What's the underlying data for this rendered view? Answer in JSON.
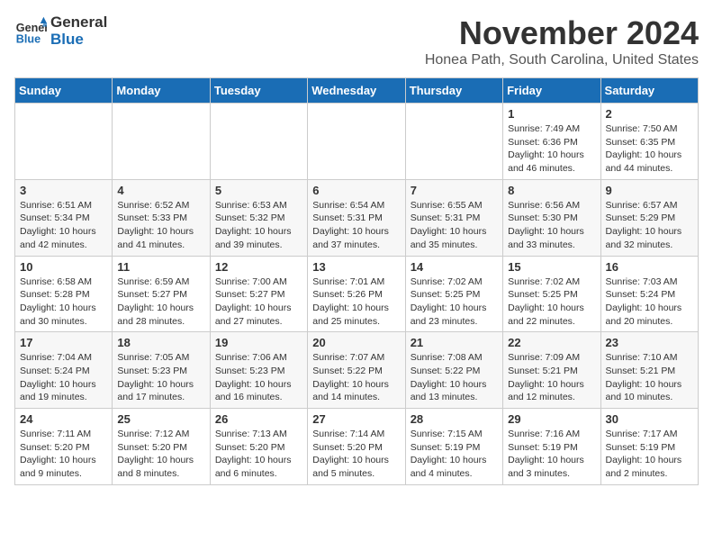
{
  "header": {
    "logo_line1": "General",
    "logo_line2": "Blue",
    "month": "November 2024",
    "location": "Honea Path, South Carolina, United States"
  },
  "weekdays": [
    "Sunday",
    "Monday",
    "Tuesday",
    "Wednesday",
    "Thursday",
    "Friday",
    "Saturday"
  ],
  "weeks": [
    [
      {
        "day": "",
        "info": ""
      },
      {
        "day": "",
        "info": ""
      },
      {
        "day": "",
        "info": ""
      },
      {
        "day": "",
        "info": ""
      },
      {
        "day": "",
        "info": ""
      },
      {
        "day": "1",
        "info": "Sunrise: 7:49 AM\nSunset: 6:36 PM\nDaylight: 10 hours\nand 46 minutes."
      },
      {
        "day": "2",
        "info": "Sunrise: 7:50 AM\nSunset: 6:35 PM\nDaylight: 10 hours\nand 44 minutes."
      }
    ],
    [
      {
        "day": "3",
        "info": "Sunrise: 6:51 AM\nSunset: 5:34 PM\nDaylight: 10 hours\nand 42 minutes."
      },
      {
        "day": "4",
        "info": "Sunrise: 6:52 AM\nSunset: 5:33 PM\nDaylight: 10 hours\nand 41 minutes."
      },
      {
        "day": "5",
        "info": "Sunrise: 6:53 AM\nSunset: 5:32 PM\nDaylight: 10 hours\nand 39 minutes."
      },
      {
        "day": "6",
        "info": "Sunrise: 6:54 AM\nSunset: 5:31 PM\nDaylight: 10 hours\nand 37 minutes."
      },
      {
        "day": "7",
        "info": "Sunrise: 6:55 AM\nSunset: 5:31 PM\nDaylight: 10 hours\nand 35 minutes."
      },
      {
        "day": "8",
        "info": "Sunrise: 6:56 AM\nSunset: 5:30 PM\nDaylight: 10 hours\nand 33 minutes."
      },
      {
        "day": "9",
        "info": "Sunrise: 6:57 AM\nSunset: 5:29 PM\nDaylight: 10 hours\nand 32 minutes."
      }
    ],
    [
      {
        "day": "10",
        "info": "Sunrise: 6:58 AM\nSunset: 5:28 PM\nDaylight: 10 hours\nand 30 minutes."
      },
      {
        "day": "11",
        "info": "Sunrise: 6:59 AM\nSunset: 5:27 PM\nDaylight: 10 hours\nand 28 minutes."
      },
      {
        "day": "12",
        "info": "Sunrise: 7:00 AM\nSunset: 5:27 PM\nDaylight: 10 hours\nand 27 minutes."
      },
      {
        "day": "13",
        "info": "Sunrise: 7:01 AM\nSunset: 5:26 PM\nDaylight: 10 hours\nand 25 minutes."
      },
      {
        "day": "14",
        "info": "Sunrise: 7:02 AM\nSunset: 5:25 PM\nDaylight: 10 hours\nand 23 minutes."
      },
      {
        "day": "15",
        "info": "Sunrise: 7:02 AM\nSunset: 5:25 PM\nDaylight: 10 hours\nand 22 minutes."
      },
      {
        "day": "16",
        "info": "Sunrise: 7:03 AM\nSunset: 5:24 PM\nDaylight: 10 hours\nand 20 minutes."
      }
    ],
    [
      {
        "day": "17",
        "info": "Sunrise: 7:04 AM\nSunset: 5:24 PM\nDaylight: 10 hours\nand 19 minutes."
      },
      {
        "day": "18",
        "info": "Sunrise: 7:05 AM\nSunset: 5:23 PM\nDaylight: 10 hours\nand 17 minutes."
      },
      {
        "day": "19",
        "info": "Sunrise: 7:06 AM\nSunset: 5:23 PM\nDaylight: 10 hours\nand 16 minutes."
      },
      {
        "day": "20",
        "info": "Sunrise: 7:07 AM\nSunset: 5:22 PM\nDaylight: 10 hours\nand 14 minutes."
      },
      {
        "day": "21",
        "info": "Sunrise: 7:08 AM\nSunset: 5:22 PM\nDaylight: 10 hours\nand 13 minutes."
      },
      {
        "day": "22",
        "info": "Sunrise: 7:09 AM\nSunset: 5:21 PM\nDaylight: 10 hours\nand 12 minutes."
      },
      {
        "day": "23",
        "info": "Sunrise: 7:10 AM\nSunset: 5:21 PM\nDaylight: 10 hours\nand 10 minutes."
      }
    ],
    [
      {
        "day": "24",
        "info": "Sunrise: 7:11 AM\nSunset: 5:20 PM\nDaylight: 10 hours\nand 9 minutes."
      },
      {
        "day": "25",
        "info": "Sunrise: 7:12 AM\nSunset: 5:20 PM\nDaylight: 10 hours\nand 8 minutes."
      },
      {
        "day": "26",
        "info": "Sunrise: 7:13 AM\nSunset: 5:20 PM\nDaylight: 10 hours\nand 6 minutes."
      },
      {
        "day": "27",
        "info": "Sunrise: 7:14 AM\nSunset: 5:20 PM\nDaylight: 10 hours\nand 5 minutes."
      },
      {
        "day": "28",
        "info": "Sunrise: 7:15 AM\nSunset: 5:19 PM\nDaylight: 10 hours\nand 4 minutes."
      },
      {
        "day": "29",
        "info": "Sunrise: 7:16 AM\nSunset: 5:19 PM\nDaylight: 10 hours\nand 3 minutes."
      },
      {
        "day": "30",
        "info": "Sunrise: 7:17 AM\nSunset: 5:19 PM\nDaylight: 10 hours\nand 2 minutes."
      }
    ]
  ]
}
